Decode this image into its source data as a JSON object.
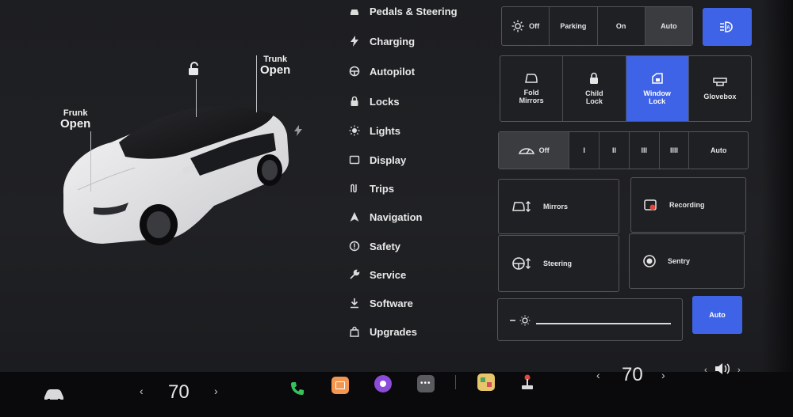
{
  "car": {
    "frunk_label": "Frunk",
    "frunk_state": "Open",
    "trunk_label": "Trunk",
    "trunk_state": "Open"
  },
  "menu": {
    "items": [
      {
        "label": "Pedals & Steering",
        "icon": "car-icon"
      },
      {
        "label": "Charging",
        "icon": "bolt-icon"
      },
      {
        "label": "Autopilot",
        "icon": "steering-wheel-icon"
      },
      {
        "label": "Locks",
        "icon": "lock-icon"
      },
      {
        "label": "Lights",
        "icon": "sun-icon"
      },
      {
        "label": "Display",
        "icon": "display-icon"
      },
      {
        "label": "Trips",
        "icon": "trips-icon"
      },
      {
        "label": "Navigation",
        "icon": "navigation-icon"
      },
      {
        "label": "Safety",
        "icon": "safety-icon"
      },
      {
        "label": "Service",
        "icon": "wrench-icon"
      },
      {
        "label": "Software",
        "icon": "download-icon"
      },
      {
        "label": "Upgrades",
        "icon": "bag-icon"
      }
    ]
  },
  "headlights": {
    "off": "Off",
    "parking": "Parking",
    "on": "On",
    "auto": "Auto",
    "selected": "Auto"
  },
  "quick": {
    "fold_mirrors": "Fold Mirrors",
    "child_lock": "Child Lock",
    "window_lock": "Window Lock",
    "glovebox": "Glovebox"
  },
  "wipers": {
    "off": "Off",
    "s1": "I",
    "s2": "II",
    "s3": "III",
    "s4": "IIII",
    "auto": "Auto",
    "selected": "Off"
  },
  "adjust": {
    "mirrors": "Mirrors",
    "steering": "Steering",
    "recording": "Recording",
    "sentry": "Sentry"
  },
  "brightness": {
    "auto": "Auto"
  },
  "bottom": {
    "driver_temp": "70",
    "passenger_temp": "70"
  },
  "colors": {
    "accent": "#3f63e6",
    "phone": "#37c35b",
    "calendar": "#f3964f",
    "media": "#8d4bd9"
  }
}
